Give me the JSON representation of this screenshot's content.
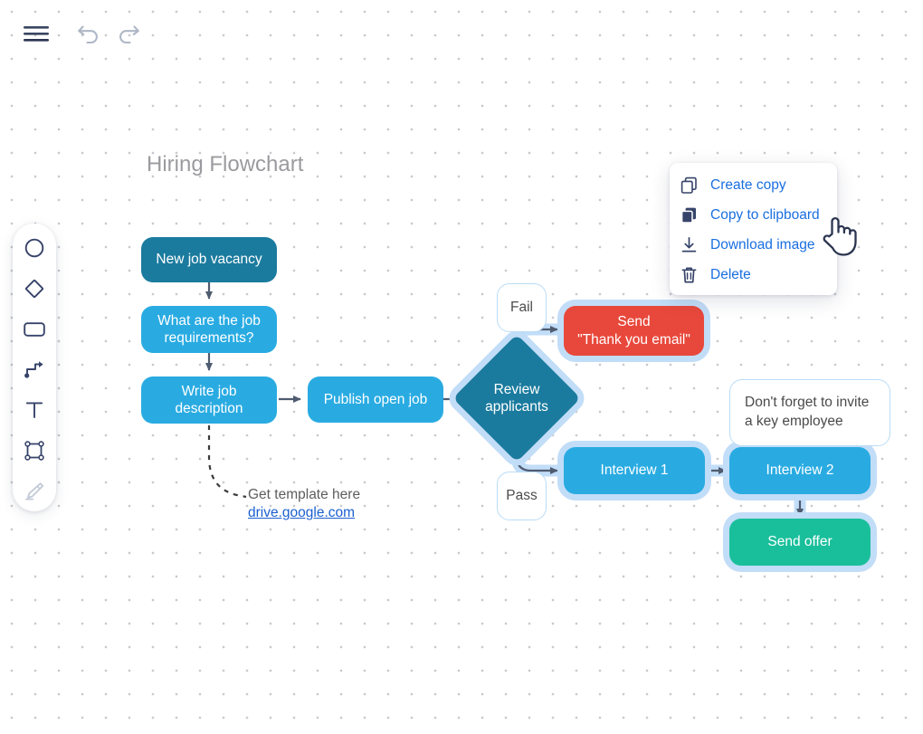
{
  "app": {
    "canvas_background": "#ffffff",
    "grid_dot_color": "#c9c9cf"
  },
  "toolbar": {
    "menu_label": "menu",
    "undo_label": "undo",
    "redo_label": "redo"
  },
  "tool_palette": {
    "tools": [
      {
        "name": "ellipse-tool",
        "label": "Ellipse",
        "active": true
      },
      {
        "name": "diamond-tool",
        "label": "Diamond",
        "active": true
      },
      {
        "name": "rectangle-tool",
        "label": "Rectangle",
        "active": true
      },
      {
        "name": "connector-tool",
        "label": "Connector",
        "active": true
      },
      {
        "name": "text-tool",
        "label": "Text",
        "active": true
      },
      {
        "name": "frame-tool",
        "label": "Frame",
        "active": true
      },
      {
        "name": "highlighter-tool",
        "label": "Highlighter",
        "active": false
      }
    ]
  },
  "context_menu": {
    "text_color": "#1a6fe0",
    "items": [
      {
        "label": "Create copy",
        "icon": "copy-outline-icon",
        "hover": false
      },
      {
        "label": "Copy to clipboard",
        "icon": "copy-filled-icon",
        "hover": true
      },
      {
        "label": "Download image",
        "icon": "download-icon",
        "hover": false
      },
      {
        "label": "Delete",
        "icon": "trash-icon",
        "hover": false
      }
    ]
  },
  "diagram": {
    "title": "Hiring Flowchart",
    "selection_halo_color": "#c2ddf7",
    "connector_color": "#4f5b70",
    "nodes": [
      {
        "id": "new-job-vacancy",
        "label": "New job vacancy",
        "color": "#1b7b9e",
        "selected": false
      },
      {
        "id": "job-requirements",
        "label": "What are the job\nrequirements?",
        "color": "#29abe2",
        "selected": false
      },
      {
        "id": "write-job-desc",
        "label": "Write job\ndescription",
        "color": "#29abe2",
        "selected": false
      },
      {
        "id": "publish-open-job",
        "label": "Publish open job",
        "color": "#29abe2",
        "selected": false
      },
      {
        "id": "review-applicants",
        "label": "Review\napplicants",
        "color": "#1b7b9e",
        "selected": true,
        "shape": "diamond"
      },
      {
        "id": "send-thank-you",
        "label": "Send\n\"Thank you email\"",
        "color": "#e8483b",
        "selected": true
      },
      {
        "id": "interview-1",
        "label": "Interview 1",
        "color": "#29abe2",
        "selected": true
      },
      {
        "id": "interview-2",
        "label": "Interview 2",
        "color": "#29abe2",
        "selected": true
      },
      {
        "id": "send-offer",
        "label": "Send offer",
        "color": "#19bf9b",
        "selected": true
      }
    ],
    "edge_labels": [
      {
        "id": "fail-label",
        "label": "Fail"
      },
      {
        "id": "pass-label",
        "label": "Pass"
      }
    ],
    "notes": [
      {
        "id": "invite-key-employee",
        "label": "Don't forget to invite\na key employee"
      }
    ],
    "annotation": {
      "text": "Get template here",
      "link_text": "drive.google.com"
    }
  },
  "cursor": {
    "type": "pointing-hand"
  },
  "node_text": {
    "new_job_vacancy": "New job vacancy",
    "job_requirements_line1": "What are the job",
    "job_requirements_line2": "requirements?",
    "write_job_desc_line1": "Write job",
    "write_job_desc_line2": "description",
    "publish_open_job": "Publish open job",
    "review_line1": "Review",
    "review_line2": "applicants",
    "thank_you_line1": "Send",
    "thank_you_line2": "\"Thank you email\"",
    "interview_1": "Interview 1",
    "interview_2": "Interview 2",
    "send_offer": "Send offer",
    "fail": "Fail",
    "pass": "Pass",
    "note_line1": "Don't forget to invite",
    "note_line2": "a key employee"
  }
}
